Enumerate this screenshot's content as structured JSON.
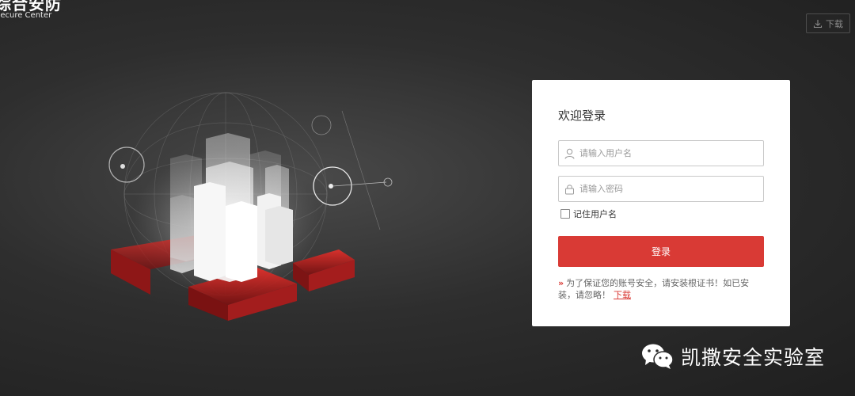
{
  "logo": {
    "name_cn": "综合安防",
    "name_en": "Secure Center"
  },
  "top_bar": {
    "download_label": "下载",
    "download_icon": "download-icon"
  },
  "login": {
    "title": "欢迎登录",
    "username_placeholder": "请输入用户名",
    "password_placeholder": "请输入密码",
    "remember_label": "记住用户名",
    "remember_checked": false,
    "submit_label": "登录",
    "notice_text": "为了保证您的账号安全，请安装根证书！如已安装，请忽略！",
    "notice_link": "下载",
    "notice_arrow": "»",
    "accent_color": "#d93a35"
  },
  "watermark": {
    "text": "凯撒安全实验室",
    "icon": "wechat-icon"
  }
}
